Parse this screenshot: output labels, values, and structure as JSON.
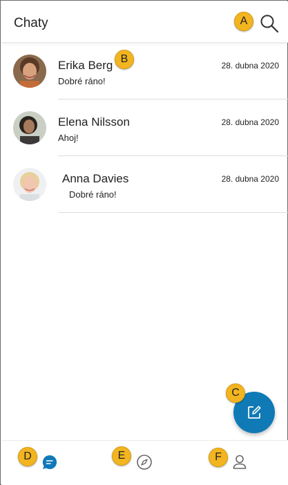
{
  "header": {
    "title": "Chaty"
  },
  "icons": {
    "search": "search-icon",
    "compose": "compose-icon",
    "chats": "chat-bubble-icon",
    "discover": "compass-icon",
    "profile": "person-icon"
  },
  "callouts": [
    "A",
    "B",
    "C",
    "D",
    "E",
    "F"
  ],
  "chats": [
    {
      "name": "Erika Berg",
      "date": "28. dubna 2020",
      "preview": "Dobré ráno!"
    },
    {
      "name": "Elena Nilsson",
      "date": "28. dubna 2020",
      "preview": "Ahoj!"
    },
    {
      "name": "Anna Davies",
      "date": "28. dubna 2020",
      "preview": "Dobré ráno!"
    }
  ],
  "colors": {
    "accent": "#0f7ab6",
    "callout": "#f2b51f",
    "nav_icon": "#666666"
  }
}
